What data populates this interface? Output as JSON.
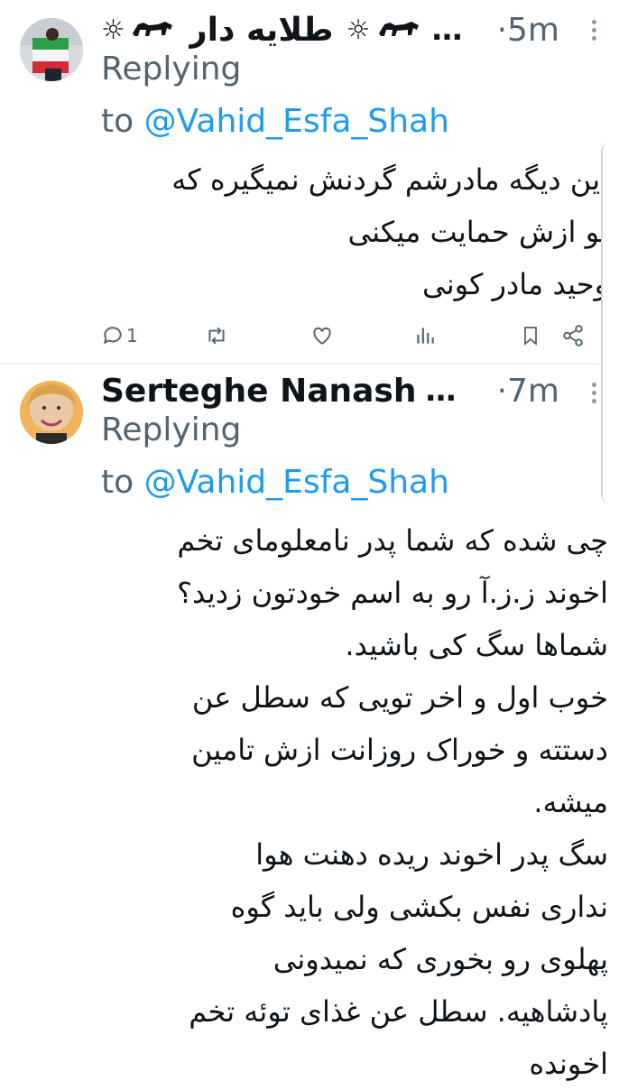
{
  "tweets": [
    {
      "author": "طلایه دار",
      "author_prefix": "…",
      "timestamp": "·5m",
      "replying_label": "Replying",
      "to_label": "to",
      "mention": "@Vahid_Esfa_Shah",
      "body_lines": [
        "این دیگه مادرشم گردنش نمیگیره که",
        "تو ازش حمایت میکنی",
        "وحید مادر کونی"
      ],
      "reply_count": "1"
    },
    {
      "author": "Serteghe Nanash",
      "author_suffix": "…",
      "timestamp": "·7m",
      "replying_label": "Replying",
      "to_label": "to",
      "mention": "@Vahid_Esfa_Shah",
      "body_lines": [
        "چی شده که شما پدر نامعلومای تخم",
        "اخوند ز.ز.آ رو به اسم خودتون زدید؟",
        "شماها سگ کی باشید.",
        "خوب اول و اخر تویی که سطل عن",
        "دستته و خوراک روزانت ازش تامین",
        "میشه.",
        "سگ پدر اخوند ریده دهنت هوا",
        "نداری نفس بکشی ولی باید گوه",
        "پهلوی رو بخوری که نمیدونی",
        "پادشاهیه. سطل عن غذای توئه تخم",
        "اخونده"
      ]
    }
  ],
  "icons": {
    "reply": "reply-icon",
    "retweet": "retweet-icon",
    "like": "like-icon",
    "views": "views-icon",
    "bookmark": "bookmark-icon",
    "share": "share-icon",
    "sun_emoji": "sun-emoji",
    "lion_emoji": "lion-and-sun-emoji"
  },
  "colors": {
    "link": "#1d9bf0",
    "secondary_text": "#536471",
    "primary_text": "#0f1419"
  }
}
